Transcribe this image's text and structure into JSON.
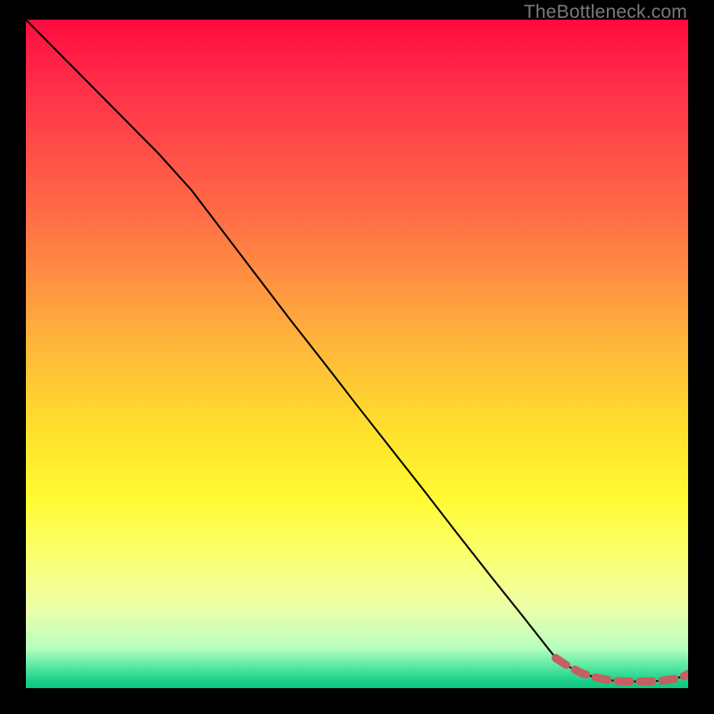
{
  "watermark": "TheBottleneck.com",
  "chart_data": {
    "type": "line",
    "title": "",
    "xlabel": "",
    "ylabel": "",
    "xlim": [
      0,
      100
    ],
    "ylim": [
      0,
      100
    ],
    "series": [
      {
        "name": "bottleneck-curve",
        "x": [
          0,
          5,
          10,
          15,
          20,
          25,
          30,
          35,
          40,
          45,
          50,
          55,
          60,
          65,
          70,
          75,
          80,
          82,
          84,
          86,
          88,
          90,
          92,
          94,
          96,
          98,
          100
        ],
        "y": [
          100,
          95,
          90,
          85,
          80,
          74.5,
          68,
          61.5,
          55,
          48.7,
          42.3,
          36,
          29.7,
          23.3,
          17,
          10.8,
          4.5,
          3.2,
          2.2,
          1.6,
          1.2,
          1.0,
          1.0,
          1.0,
          1.1,
          1.4,
          2.0
        ]
      }
    ],
    "highlight": {
      "name": "dashed-highlight",
      "style": "dashed",
      "color": "#c46060",
      "x": [
        80,
        82,
        84,
        86,
        88,
        90,
        92,
        94,
        96,
        98,
        100
      ],
      "y": [
        4.5,
        3.2,
        2.2,
        1.6,
        1.2,
        1.0,
        1.0,
        1.0,
        1.1,
        1.4,
        2.0
      ],
      "end_point": {
        "x": 100,
        "y": 2.0
      }
    },
    "gradient_bands": [
      {
        "at_y": 100,
        "color": "#ff0b3e"
      },
      {
        "at_y": 50,
        "color": "#ffb43c"
      },
      {
        "at_y": 25,
        "color": "#fffb33"
      },
      {
        "at_y": 5,
        "color": "#b8ffbf"
      },
      {
        "at_y": 0,
        "color": "#0ec77f"
      }
    ]
  }
}
